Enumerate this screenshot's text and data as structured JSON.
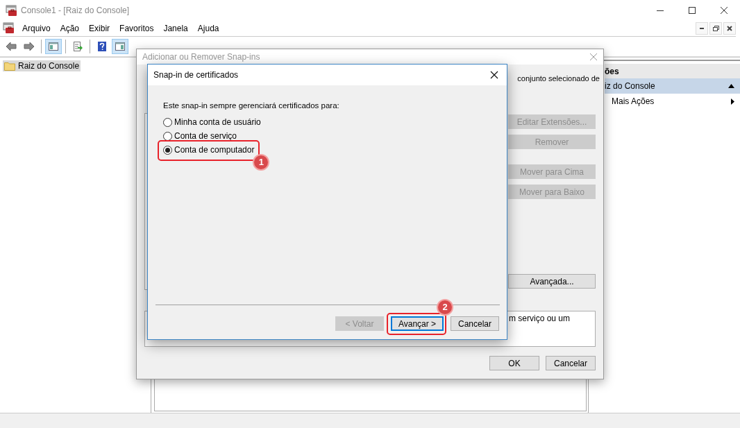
{
  "window": {
    "title": "Console1 - [Raiz do Console]"
  },
  "menu": [
    "Arquivo",
    "Ação",
    "Exibir",
    "Favoritos",
    "Janela",
    "Ajuda"
  ],
  "toolbar": [
    {
      "kind": "back",
      "pressed": false
    },
    {
      "kind": "forward",
      "pressed": false
    },
    {
      "kind": "tree",
      "pressed": true
    },
    {
      "kind": "export",
      "pressed": false
    },
    {
      "kind": "help",
      "pressed": false
    },
    {
      "kind": "actions",
      "pressed": true
    }
  ],
  "tree": [
    {
      "label": "Raiz do Console",
      "selected": true
    }
  ],
  "actions_pane": {
    "header": "ões",
    "items": [
      {
        "label": "iz do Console",
        "kind": "section",
        "selected": true
      },
      {
        "label": "Mais Ações",
        "kind": "submenu",
        "selected": false
      }
    ]
  },
  "back_dialog": {
    "title": "Adicionar ou Remover Snap-ins",
    "line_1_end": "conjunto selecionado de",
    "buttons": [
      {
        "label": "Editar Extensões...",
        "disabled": true
      },
      {
        "label": "Remover",
        "disabled": true
      },
      {
        "label": "Mover para Cima",
        "disabled": true
      },
      {
        "label": "Mover para Baixo",
        "disabled": true
      },
      {
        "label": "Avançada...",
        "disabled": false
      }
    ],
    "description": "m serviço ou um",
    "footer_buttons": [
      "OK",
      "Cancelar"
    ]
  },
  "front_dialog": {
    "title": "Snap-in de certificados",
    "prompt": "Este snap-in sempre gerenciará certificados para:",
    "options": [
      {
        "label": "Minha conta de usuário",
        "selected": false
      },
      {
        "label": "Conta de serviço",
        "selected": false
      },
      {
        "label": "Conta de computador",
        "selected": true,
        "callout": "1"
      }
    ],
    "buttons": [
      {
        "label": "< Voltar",
        "disabled": true,
        "default": false
      },
      {
        "label": "Avançar >",
        "disabled": false,
        "default": true,
        "callout": "2"
      },
      {
        "label": "Cancelar",
        "disabled": false,
        "default": false
      }
    ]
  }
}
